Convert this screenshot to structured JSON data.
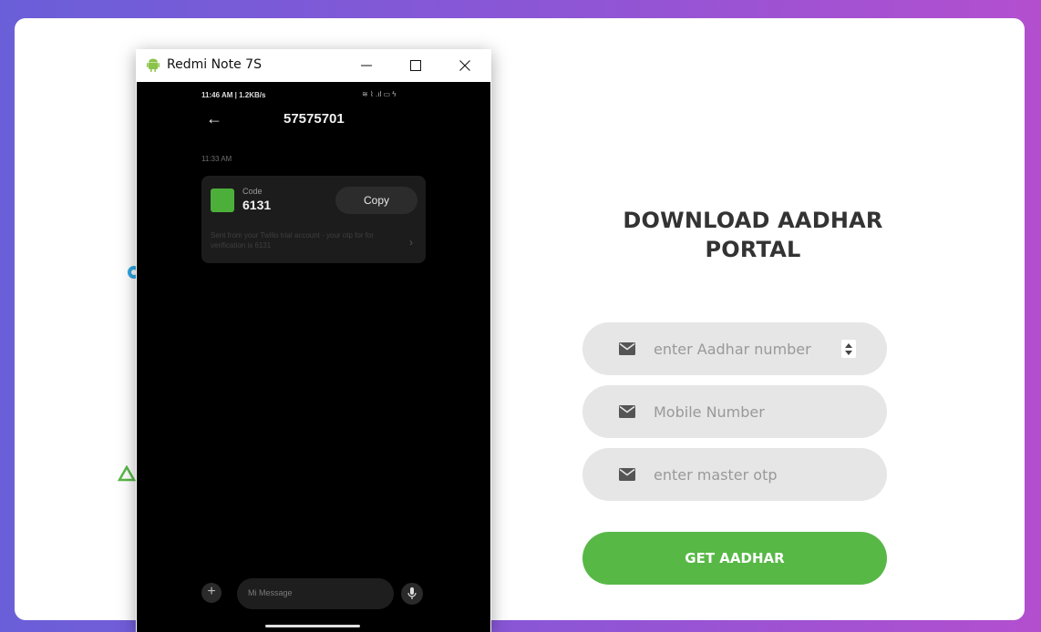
{
  "colors": {
    "accent": "#57b846",
    "field_bg": "#e6e6e6",
    "title": "#333333",
    "placeholder": "#999999",
    "deco_circle": "#2fa7e2",
    "deco_triangle": "#57b846"
  },
  "form": {
    "title": "DOWNLOAD AADHAR PORTAL",
    "aadhar_placeholder": "enter Aadhar number",
    "mobile_placeholder": "Mobile Number",
    "otp_placeholder": "enter master otp",
    "submit_label": "GET AADHAR",
    "field_icon": "envelope-icon"
  },
  "window": {
    "title": "Redmi Note 7S",
    "icon": "android-icon",
    "controls": [
      "minimize-icon",
      "maximize-icon",
      "close-icon"
    ]
  },
  "phone": {
    "status_left": "11:46 AM | 1.2KB/s",
    "status_right": "≋ ⌇ .ıl ▭ ϟ",
    "sender": "57575701",
    "message_time": "11:33 AM",
    "code_label": "Code",
    "code_value": "6131",
    "copy_label": "Copy",
    "message_body": "Sent from your Twilio trial account - your otp for for verification is 6131",
    "input_placeholder": "Mi Message",
    "back_glyph": "←",
    "plus_glyph": "+",
    "chevron_glyph": "›"
  }
}
